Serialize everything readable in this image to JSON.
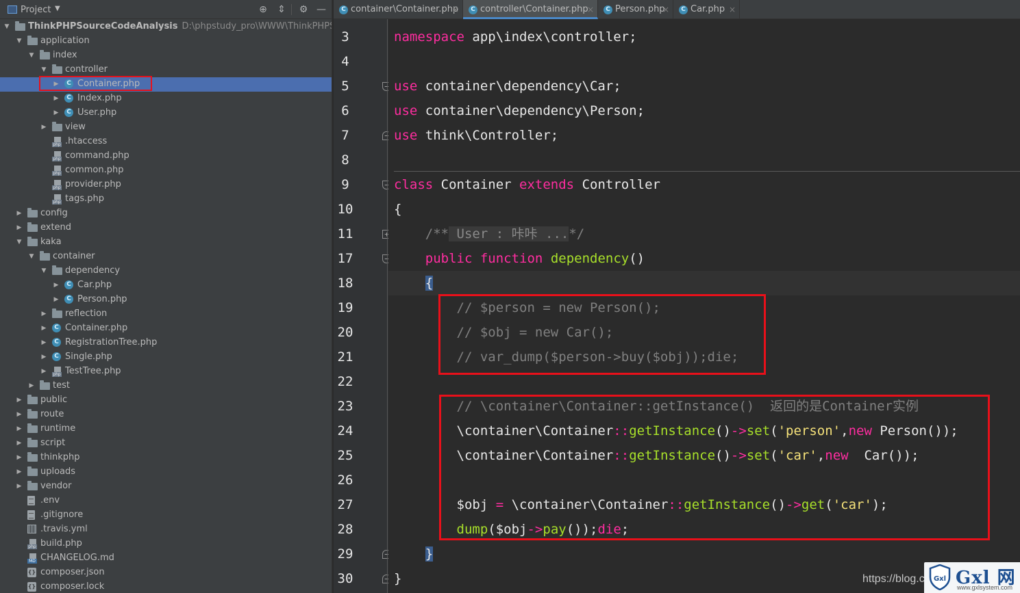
{
  "project_panel": {
    "title": "Project",
    "tree": [
      {
        "label": "ThinkPHPSourceCodeAnalysis",
        "path": "D:\\phpstudy_pro\\WWW\\ThinkPHPSourceCo",
        "depth": 0,
        "icon": "folder",
        "expanded": true,
        "bold": true
      },
      {
        "label": "application",
        "depth": 1,
        "icon": "folder",
        "expanded": true
      },
      {
        "label": "index",
        "depth": 2,
        "icon": "folder",
        "expanded": true
      },
      {
        "label": "controller",
        "depth": 3,
        "icon": "folder",
        "expanded": true
      },
      {
        "label": "Container.php",
        "depth": 4,
        "icon": "class",
        "expanded": false,
        "selected": true
      },
      {
        "label": "Index.php",
        "depth": 4,
        "icon": "class",
        "expanded": false
      },
      {
        "label": "User.php",
        "depth": 4,
        "icon": "class",
        "expanded": false
      },
      {
        "label": "view",
        "depth": 3,
        "icon": "folder",
        "expanded": false
      },
      {
        "label": ".htaccess",
        "depth": 3,
        "icon": "php",
        "leaf": true
      },
      {
        "label": "command.php",
        "depth": 3,
        "icon": "php",
        "leaf": true
      },
      {
        "label": "common.php",
        "depth": 3,
        "icon": "php",
        "leaf": true
      },
      {
        "label": "provider.php",
        "depth": 3,
        "icon": "php",
        "leaf": true
      },
      {
        "label": "tags.php",
        "depth": 3,
        "icon": "php",
        "leaf": true
      },
      {
        "label": "config",
        "depth": 1,
        "icon": "folder",
        "expanded": false
      },
      {
        "label": "extend",
        "depth": 1,
        "icon": "folder",
        "expanded": false
      },
      {
        "label": "kaka",
        "depth": 1,
        "icon": "folder",
        "expanded": true
      },
      {
        "label": "container",
        "depth": 2,
        "icon": "folder",
        "expanded": true
      },
      {
        "label": "dependency",
        "depth": 3,
        "icon": "folder",
        "expanded": true
      },
      {
        "label": "Car.php",
        "depth": 4,
        "icon": "class",
        "expanded": false
      },
      {
        "label": "Person.php",
        "depth": 4,
        "icon": "class",
        "expanded": false
      },
      {
        "label": "reflection",
        "depth": 3,
        "icon": "folder",
        "expanded": false
      },
      {
        "label": "Container.php",
        "depth": 3,
        "icon": "class",
        "expanded": false
      },
      {
        "label": "RegistrationTree.php",
        "depth": 3,
        "icon": "class",
        "expanded": false
      },
      {
        "label": "Single.php",
        "depth": 3,
        "icon": "class",
        "expanded": false
      },
      {
        "label": "TestTree.php",
        "depth": 3,
        "icon": "php",
        "expanded": false
      },
      {
        "label": "test",
        "depth": 2,
        "icon": "folder",
        "expanded": false
      },
      {
        "label": "public",
        "depth": 1,
        "icon": "folder",
        "expanded": false
      },
      {
        "label": "route",
        "depth": 1,
        "icon": "folder",
        "expanded": false
      },
      {
        "label": "runtime",
        "depth": 1,
        "icon": "folder",
        "expanded": false
      },
      {
        "label": "script",
        "depth": 1,
        "icon": "folder",
        "expanded": false
      },
      {
        "label": "thinkphp",
        "depth": 1,
        "icon": "folder",
        "expanded": false
      },
      {
        "label": "uploads",
        "depth": 1,
        "icon": "folder",
        "expanded": false
      },
      {
        "label": "vendor",
        "depth": 1,
        "icon": "folder",
        "expanded": false
      },
      {
        "label": ".env",
        "depth": 1,
        "icon": "text",
        "leaf": true
      },
      {
        "label": ".gitignore",
        "depth": 1,
        "icon": "text",
        "leaf": true
      },
      {
        "label": ".travis.yml",
        "depth": 1,
        "icon": "yml",
        "leaf": true
      },
      {
        "label": "build.php",
        "depth": 1,
        "icon": "php",
        "leaf": true
      },
      {
        "label": "CHANGELOG.md",
        "depth": 1,
        "icon": "md",
        "leaf": true
      },
      {
        "label": "composer.json",
        "depth": 1,
        "icon": "json",
        "leaf": true
      },
      {
        "label": "composer.lock",
        "depth": 1,
        "icon": "json",
        "leaf": true
      }
    ]
  },
  "editor": {
    "tabs": [
      {
        "label": "container\\Container.php",
        "active": false
      },
      {
        "label": "controller\\Container.php",
        "active": true
      },
      {
        "label": "Person.php",
        "active": false
      },
      {
        "label": "Car.php",
        "active": false
      }
    ],
    "current_line": "18",
    "lines": [
      {
        "num": "3",
        "tokens": [
          {
            "t": "namespace",
            "c": "kw"
          },
          {
            "t": " app\\index\\controller;",
            "c": ""
          }
        ]
      },
      {
        "num": "4",
        "tokens": []
      },
      {
        "num": "5",
        "fold": "top",
        "tokens": [
          {
            "t": "use",
            "c": "kw"
          },
          {
            "t": " container\\dependency\\Car;",
            "c": ""
          }
        ]
      },
      {
        "num": "6",
        "tokens": [
          {
            "t": "use",
            "c": "kw"
          },
          {
            "t": " container\\dependency\\Person;",
            "c": ""
          }
        ]
      },
      {
        "num": "7",
        "fold": "bottom",
        "tokens": [
          {
            "t": "use",
            "c": "kw"
          },
          {
            "t": " think\\Controller;",
            "c": ""
          }
        ]
      },
      {
        "num": "8",
        "sep_after": true,
        "tokens": []
      },
      {
        "num": "9",
        "fold": "top",
        "tokens": [
          {
            "t": "class",
            "c": "kw"
          },
          {
            "t": " Container ",
            "c": ""
          },
          {
            "t": "extends",
            "c": "kw"
          },
          {
            "t": " Controller",
            "c": ""
          }
        ]
      },
      {
        "num": "10",
        "tokens": [
          {
            "t": "{",
            "c": ""
          }
        ]
      },
      {
        "num": "11",
        "fold": "plus",
        "tokens": [
          {
            "t": "    /**",
            "c": "cmt"
          },
          {
            "t": " User : 咔咔 ...",
            "c": "collapsed"
          },
          {
            "t": "*/",
            "c": "cmt"
          }
        ]
      },
      {
        "num": "17",
        "fold": "top",
        "tokens": [
          {
            "t": "    ",
            "c": ""
          },
          {
            "t": "public function",
            "c": "kw"
          },
          {
            "t": " ",
            "c": ""
          },
          {
            "t": "dependency",
            "c": "fn"
          },
          {
            "t": "()",
            "c": ""
          }
        ]
      },
      {
        "num": "18",
        "tokens": [
          {
            "t": "    ",
            "c": ""
          },
          {
            "t": "{",
            "c": "brace-hl"
          }
        ]
      },
      {
        "num": "19",
        "tokens": [
          {
            "t": "        // $person = new Person();",
            "c": "cmt"
          }
        ]
      },
      {
        "num": "20",
        "tokens": [
          {
            "t": "        // $obj = new Car();",
            "c": "cmt"
          }
        ]
      },
      {
        "num": "21",
        "tokens": [
          {
            "t": "        // var_dump($person->buy($obj));die;",
            "c": "cmt"
          }
        ]
      },
      {
        "num": "22",
        "tokens": []
      },
      {
        "num": "23",
        "tokens": [
          {
            "t": "        // \\container\\Container::getInstance()  返回的是Container实例",
            "c": "cmt"
          }
        ]
      },
      {
        "num": "24",
        "tokens": [
          {
            "t": "        \\container\\Container",
            "c": ""
          },
          {
            "t": "::",
            "c": "op"
          },
          {
            "t": "getInstance",
            "c": "fn"
          },
          {
            "t": "()",
            "c": ""
          },
          {
            "t": "->",
            "c": "op"
          },
          {
            "t": "set",
            "c": "fn"
          },
          {
            "t": "(",
            "c": ""
          },
          {
            "t": "'person'",
            "c": "str"
          },
          {
            "t": ",",
            "c": ""
          },
          {
            "t": "new",
            "c": "kw"
          },
          {
            "t": " Person());",
            "c": ""
          }
        ]
      },
      {
        "num": "25",
        "tokens": [
          {
            "t": "        \\container\\Container",
            "c": ""
          },
          {
            "t": "::",
            "c": "op"
          },
          {
            "t": "getInstance",
            "c": "fn"
          },
          {
            "t": "()",
            "c": ""
          },
          {
            "t": "->",
            "c": "op"
          },
          {
            "t": "set",
            "c": "fn"
          },
          {
            "t": "(",
            "c": ""
          },
          {
            "t": "'car'",
            "c": "str"
          },
          {
            "t": ",",
            "c": ""
          },
          {
            "t": "new",
            "c": "kw"
          },
          {
            "t": "  Car());",
            "c": ""
          }
        ]
      },
      {
        "num": "26",
        "tokens": []
      },
      {
        "num": "27",
        "tokens": [
          {
            "t": "        $obj ",
            "c": ""
          },
          {
            "t": "=",
            "c": "op"
          },
          {
            "t": " \\container\\Container",
            "c": ""
          },
          {
            "t": "::",
            "c": "op"
          },
          {
            "t": "getInstance",
            "c": "fn"
          },
          {
            "t": "()",
            "c": ""
          },
          {
            "t": "->",
            "c": "op"
          },
          {
            "t": "get",
            "c": "fn"
          },
          {
            "t": "(",
            "c": ""
          },
          {
            "t": "'car'",
            "c": "str"
          },
          {
            "t": ");",
            "c": ""
          }
        ]
      },
      {
        "num": "28",
        "tokens": [
          {
            "t": "        ",
            "c": ""
          },
          {
            "t": "dump",
            "c": "fn"
          },
          {
            "t": "($obj",
            "c": ""
          },
          {
            "t": "->",
            "c": "op"
          },
          {
            "t": "pay",
            "c": "fn"
          },
          {
            "t": "());",
            "c": ""
          },
          {
            "t": "die",
            "c": "kw"
          },
          {
            "t": ";",
            "c": ""
          }
        ]
      },
      {
        "num": "29",
        "fold": "bottom",
        "tokens": [
          {
            "t": "    ",
            "c": ""
          },
          {
            "t": "}",
            "c": "brace-hl"
          }
        ]
      },
      {
        "num": "30",
        "fold": "bottom",
        "tokens": [
          {
            "t": "}",
            "c": ""
          }
        ]
      }
    ]
  },
  "watermark": {
    "url_text": "https://blog.c",
    "brand": "Gxl 网",
    "site": "www.gxlsystem.com"
  },
  "colors": {
    "keyword": "#ff2da0",
    "function": "#a8e02a",
    "string": "#f6e27a",
    "comment": "#808080",
    "highlight_box": "#e8101a",
    "selection": "#4b6eaf"
  },
  "icons": {
    "project_window": "project-window-icon",
    "locate": "crosshair-icon",
    "collapse_all": "collapse-all-icon",
    "settings": "gear-icon",
    "hide": "minimize-icon"
  }
}
